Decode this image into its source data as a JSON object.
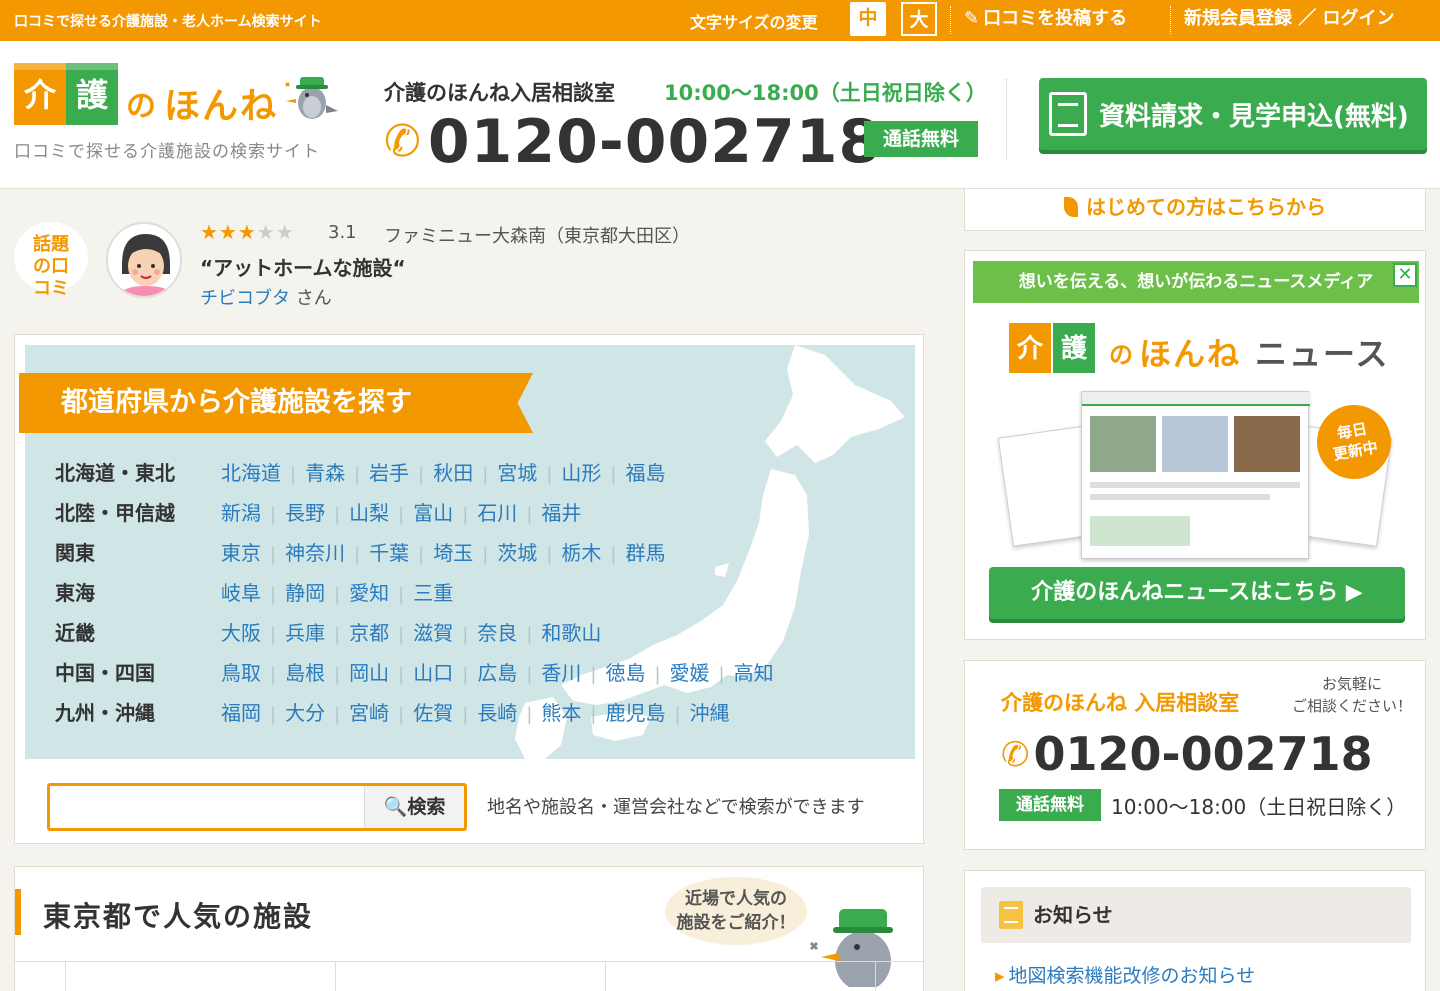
{
  "topbar": {
    "tagline": "口コミで探せる介護施設・老人ホーム検索サイト",
    "font_size_label": "文字サイズの変更",
    "font_medium": "中",
    "font_large": "大",
    "post_review": "口コミを投稿する",
    "register_login": "新規会員登録 ／ ログイン"
  },
  "header": {
    "logo_kanji1": "介",
    "logo_kanji2": "護",
    "logo_no": "の",
    "logo_honne": "ほんね",
    "logo_subtitle": "口コミで探せる介護施設の検索サイト",
    "contact_title": "介護のほんね入居相談室",
    "contact_hours": "10:00〜18:00（土日祝日除く）",
    "phone": "0120-002718",
    "free_call": "通話無料",
    "request_button": "資料請求・見学申込(無料)"
  },
  "review": {
    "badge": "話題の口コミ",
    "stars_on": "★★★",
    "stars_off": "★★",
    "rating": "3.1",
    "facility": "ファミニュー大森南（東京都大田区）",
    "quote": "“アットホームな施設“",
    "user": "チビコブタ",
    "honorific": "さん"
  },
  "prefecture_search": {
    "title": "都道府県から介護施設を探す",
    "regions": [
      {
        "name": "北海道・東北",
        "prefs": [
          "北海道",
          "青森",
          "岩手",
          "秋田",
          "宮城",
          "山形",
          "福島"
        ]
      },
      {
        "name": "北陸・甲信越",
        "prefs": [
          "新潟",
          "長野",
          "山梨",
          "富山",
          "石川",
          "福井"
        ]
      },
      {
        "name": "関東",
        "prefs": [
          "東京",
          "神奈川",
          "千葉",
          "埼玉",
          "茨城",
          "栃木",
          "群馬"
        ]
      },
      {
        "name": "東海",
        "prefs": [
          "岐阜",
          "静岡",
          "愛知",
          "三重"
        ]
      },
      {
        "name": "近畿",
        "prefs": [
          "大阪",
          "兵庫",
          "京都",
          "滋賀",
          "奈良",
          "和歌山"
        ]
      },
      {
        "name": "中国・四国",
        "prefs": [
          "鳥取",
          "島根",
          "岡山",
          "山口",
          "広島",
          "香川",
          "徳島",
          "愛媛",
          "高知"
        ]
      },
      {
        "name": "九州・沖縄",
        "prefs": [
          "福岡",
          "大分",
          "宮崎",
          "佐賀",
          "長崎",
          "熊本",
          "鹿児島",
          "沖縄"
        ]
      }
    ],
    "search_value": "",
    "search_button": "検索",
    "search_hint": "地名や施設名・運営会社などで検索ができます"
  },
  "popular": {
    "title": "東京都で人気の施設",
    "note_line1": "近場で人気の",
    "note_line2": "施設をご紹介！"
  },
  "sidebar": {
    "first_time": "はじめての方はこちらから",
    "news_strip": "想いを伝える、想いが伝わるニュースメディア",
    "close": "✕",
    "news_logo_kanji1": "介",
    "news_logo_kanji2": "護",
    "news_logo_no": "の",
    "news_logo_honne": "ほんね",
    "news_logo_news": "ニュース",
    "daily_badge_line1": "毎日",
    "daily_badge_line2": "更新中",
    "news_button": "介護のほんねニュースはこちら ▶",
    "consult_title": "介護のほんね 入居相談室",
    "consult_bubble_line1": "お気軽に",
    "consult_bubble_line2": "ご相談ください！",
    "consult_phone": "0120-002718",
    "consult_free": "通話無料",
    "consult_hours": "10:00〜18:00（土日祝日除く）",
    "notice_title": "お知らせ",
    "notice_item": "地図検索機能改修のお知らせ"
  },
  "colors": {
    "brand_orange": "#f39800",
    "brand_green": "#3aac4f",
    "link_blue": "#2b7bbf",
    "map_water": "#cfe5e6"
  }
}
